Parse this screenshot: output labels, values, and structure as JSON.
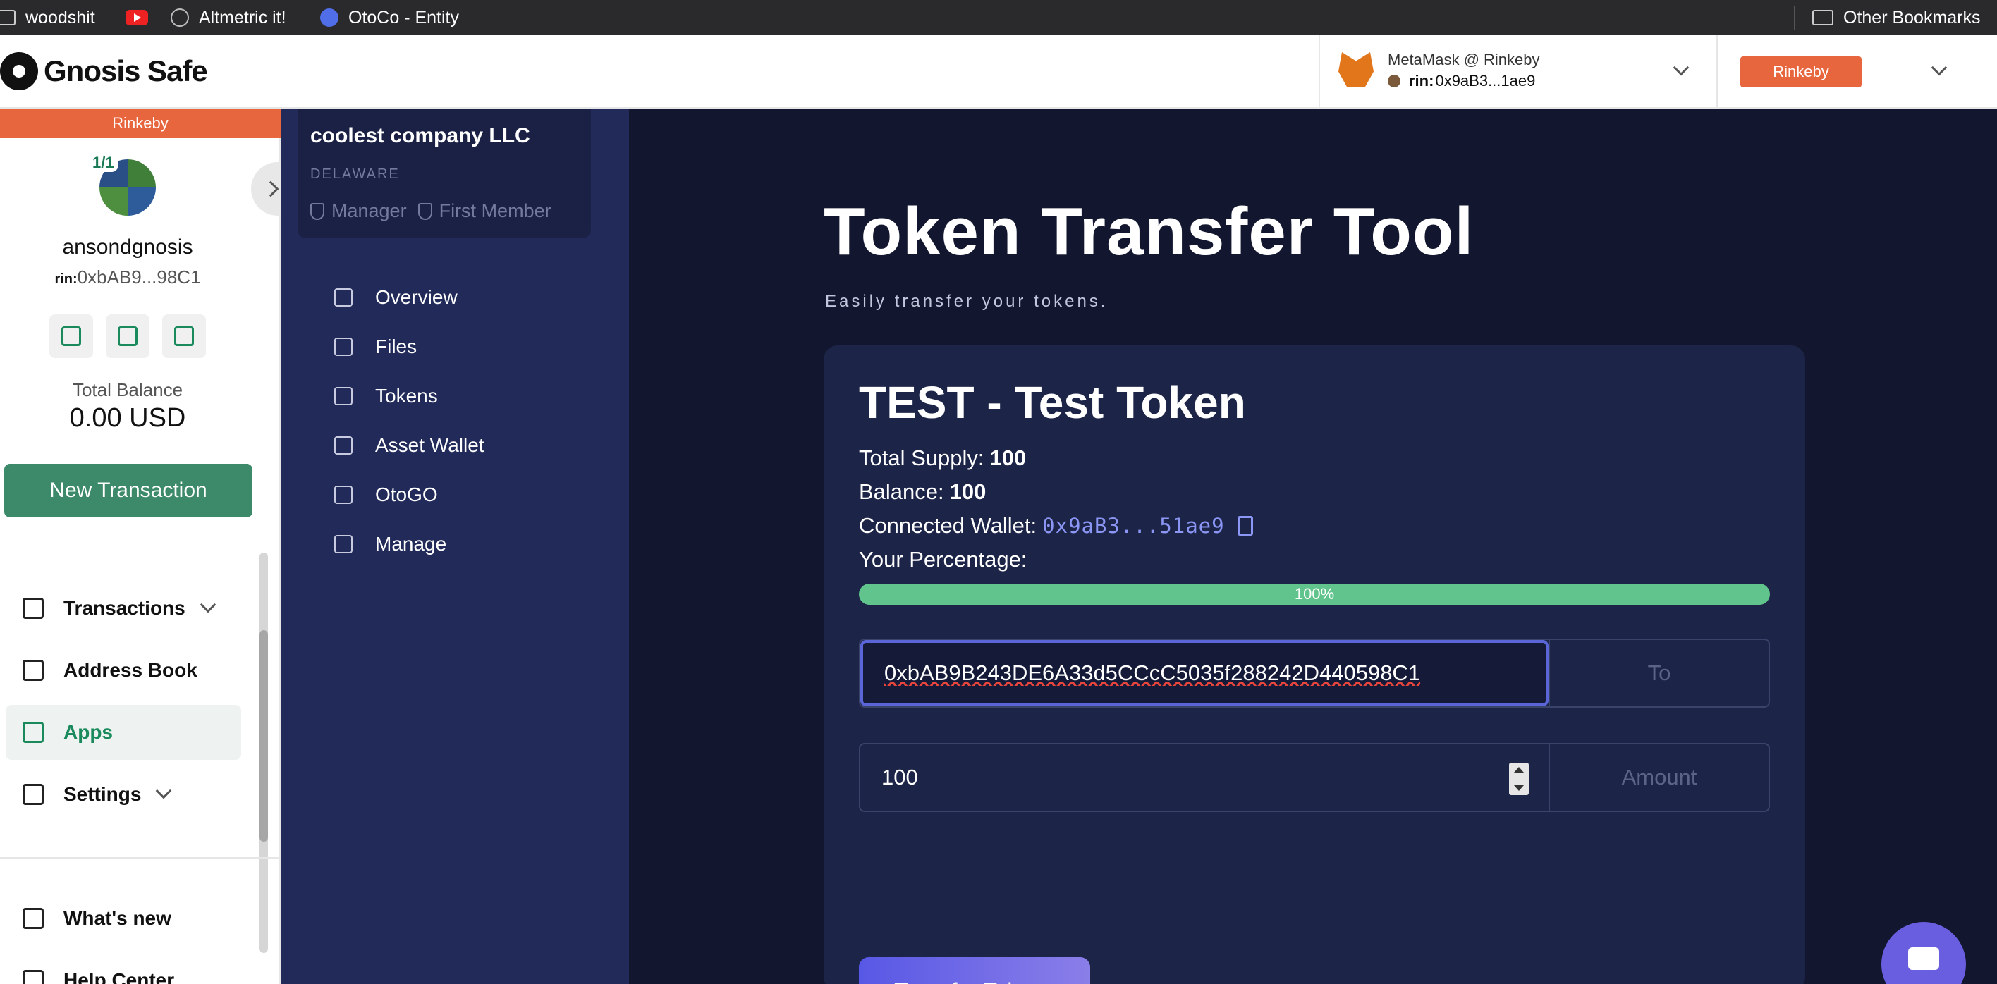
{
  "bookmarks": {
    "items": [
      {
        "label": "woodshit",
        "icon": "folder-icon"
      },
      {
        "label": "",
        "icon": "youtube-icon"
      },
      {
        "label": "Altmetric it!",
        "icon": "globe-icon"
      },
      {
        "label": "OtoCo - Entity",
        "icon": "otoco-icon"
      }
    ],
    "other": "Other Bookmarks"
  },
  "header": {
    "app_name": "Gnosis Safe",
    "wallet_name": "MetaMask @ Rinkeby",
    "wallet_prefix": "rin:",
    "wallet_address": "0x9aB3...1ae9",
    "network": "Rinkeby",
    "network_color": "#e8663d"
  },
  "safe": {
    "network_band": "Rinkeby",
    "threshold": "1/1",
    "name": "ansondgnosis",
    "addr_prefix": "rin:",
    "address": "0xbAB9...98C1",
    "total_balance_label": "Total Balance",
    "total_balance": "0.00 USD",
    "new_transaction": "New Transaction",
    "nav": [
      {
        "label": "Transactions",
        "icon": "transactions-icon"
      },
      {
        "label": "Address Book",
        "icon": "address-book-icon"
      },
      {
        "label": "Apps",
        "icon": "apps-icon"
      },
      {
        "label": "Settings",
        "icon": "settings-icon"
      }
    ],
    "footer": [
      {
        "label": "What's new",
        "icon": "gift-icon"
      },
      {
        "label": "Help Center",
        "icon": "help-icon"
      }
    ],
    "accent": "#1a8a5c"
  },
  "otoco": {
    "company_name": "coolest company LLC",
    "jurisdiction": "DELAWARE",
    "roles": [
      "Manager",
      "First Member"
    ],
    "nav": [
      {
        "label": "Overview",
        "icon": "home-icon"
      },
      {
        "label": "Files",
        "icon": "file-icon"
      },
      {
        "label": "Tokens",
        "icon": "cube-icon"
      },
      {
        "label": "Asset Wallet",
        "icon": "wallet-icon"
      },
      {
        "label": "OtoGO",
        "icon": "chart-icon"
      },
      {
        "label": "Manage",
        "icon": "gear-icon"
      }
    ]
  },
  "main": {
    "title": "Token Transfer Tool",
    "subtitle": "Easily transfer your tokens.",
    "token_name": "TEST - Test Token",
    "total_supply_label": "Total Supply:",
    "total_supply": "100",
    "balance_label": "Balance:",
    "balance": "100",
    "connected_wallet_label": "Connected Wallet:",
    "connected_wallet": "0x9aB3...51ae9",
    "percentage_label": "Your Percentage:",
    "percentage_text": "100%",
    "percentage_value": 1.0,
    "to_value": "0xbAB9B243DE6A33d5CCcC5035f288242D440598C1",
    "to_label": "To",
    "amount_value": "100",
    "amount_label": "Amount",
    "transfer_button": "Transfer Tokens"
  }
}
